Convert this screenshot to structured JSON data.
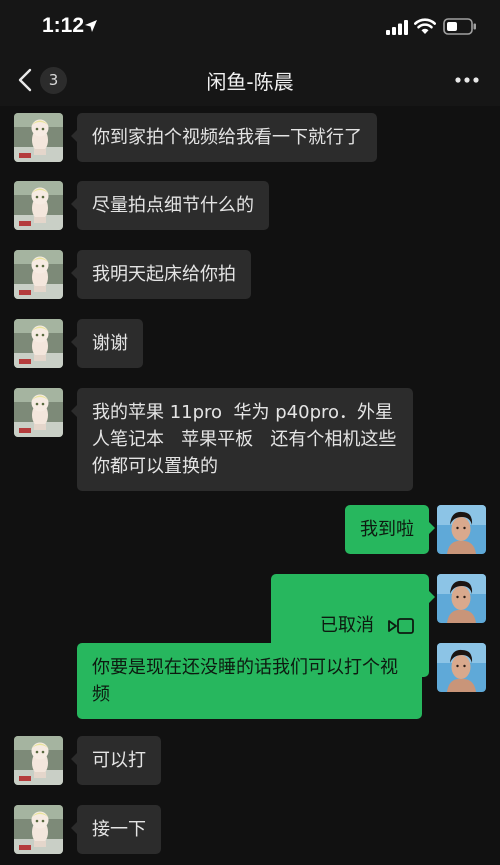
{
  "status_bar": {
    "time": "1:12"
  },
  "nav": {
    "badge_count": "3",
    "title": "闲鱼-陈晨"
  },
  "colors": {
    "background": "#111111",
    "incoming_bubble": "#2c2c2c",
    "outgoing_bubble": "#27b75e"
  },
  "messages": [
    {
      "side": "in",
      "text": "你到家拍个视频给我看一下就行了"
    },
    {
      "side": "in",
      "text": "尽量拍点细节什么的"
    },
    {
      "side": "in",
      "text": "我明天起床给你拍"
    },
    {
      "side": "in",
      "text": "谢谢"
    },
    {
      "side": "in",
      "text": "我的苹果 11pro  华为 p40pro．外星人笔记本   苹果平板   还有个相机这些你都可以置换的"
    },
    {
      "side": "out",
      "text": "我到啦"
    },
    {
      "side": "out",
      "text": "已取消",
      "icon": "video-call-icon"
    },
    {
      "side": "out",
      "text": "你要是现在还没睡的话我们可以打个视频"
    },
    {
      "side": "in",
      "text": "可以打"
    },
    {
      "side": "in",
      "text": "接一下"
    }
  ]
}
